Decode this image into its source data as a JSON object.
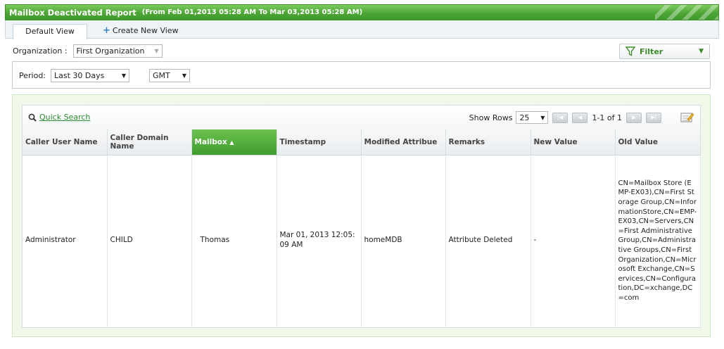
{
  "report": {
    "title": "Mailbox Deactivated Report",
    "range": "(From Feb 01,2013 05:28 AM To Mar 03,2013 05:28 AM)"
  },
  "tabs": {
    "default_view": "Default View",
    "create_new_view": "Create New View"
  },
  "organization": {
    "label": "Organization :",
    "value": "First Organization"
  },
  "filter": {
    "label": "Filter"
  },
  "period": {
    "label": "Period:",
    "value": "Last 30 Days",
    "timezone": "GMT"
  },
  "toolbar": {
    "quick_search": "Quick Search",
    "show_rows_label": "Show Rows",
    "show_rows_value": "25",
    "page_info": "1-1 of 1"
  },
  "table": {
    "columns": [
      "Caller User Name",
      "Caller Domain Name",
      "Mailbox",
      "Timestamp",
      "Modified Attribue",
      "Remarks",
      "New Value",
      "Old Value"
    ],
    "sorted_column": "Mailbox",
    "rows": [
      {
        "caller_user_name": "Administrator",
        "caller_domain_name": "CHILD",
        "mailbox": "Thomas",
        "timestamp": "Mar 01, 2013 12:05:09 AM",
        "modified_attribute": "homeMDB",
        "remarks": "Attribute Deleted",
        "new_value": "-",
        "old_value": "CN=Mailbox Store (EMP-EX03),CN=First Storage Group,CN=InformationStore,CN=EMP-EX03,CN=Servers,CN=First Administrative Group,CN=Administrative Groups,CN=First Organization,CN=Microsoft Exchange,CN=Services,CN=Configuration,DC=xchange,DC=com"
      }
    ]
  },
  "colors": {
    "accent_green": "#4ea536",
    "link_green": "#2c8a2c",
    "panel_bg": "#eff8e9"
  },
  "icons": {
    "search": "search-icon",
    "plus": "plus-icon",
    "filter": "funnel-icon",
    "edit": "edit-columns-icon"
  }
}
